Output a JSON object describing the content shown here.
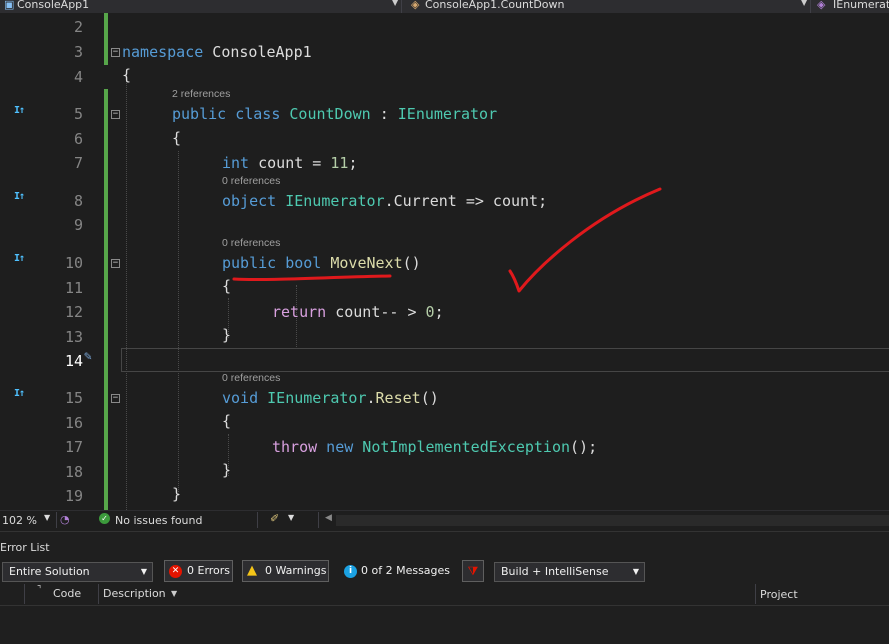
{
  "nav": {
    "project": "ConsoleApp1",
    "type": "ConsoleApp1.CountDown",
    "member": "IEnumerat"
  },
  "editor": {
    "line_numbers": [
      "2",
      "3",
      "4",
      "5",
      "6",
      "7",
      "8",
      "9",
      "10",
      "11",
      "12",
      "13",
      "14",
      "15",
      "16",
      "17",
      "18",
      "19"
    ],
    "ref_labels": {
      "class_refs": "2 references",
      "current_refs": "0 references",
      "movenext_refs": "0 references",
      "reset_refs": "0 references"
    },
    "code": {
      "l3_kw": "namespace",
      "l3_name": " ConsoleApp1",
      "l4": "{",
      "l5_kw": "public class",
      "l5_type": " CountDown",
      "l5_colon": " : ",
      "l5_iface": "IEnumerator",
      "l6": "{",
      "l7_kw": "int",
      "l7_rest": " count = ",
      "l7_num": "11",
      "l7_end": ";",
      "l8_kw": "object",
      "l8_iface": " IEnumerator",
      "l8_rest": ".Current => count;",
      "l10_kw": "public bool",
      "l10_fn": " MoveNext",
      "l10_end": "()",
      "l11": "{",
      "l12_kw": "return",
      "l12_rest": " count-- > ",
      "l12_num": "0",
      "l12_end": ";",
      "l13": "}",
      "l15_kw": "void",
      "l15_iface": " IEnumerator",
      "l15_dot": ".",
      "l15_fn": "Reset",
      "l15_end": "()",
      "l16": "{",
      "l17_kw": "throw",
      "l17_kw2": " new",
      "l17_type": " NotImplementedException",
      "l17_end": "();",
      "l18": "}",
      "l19": "}"
    }
  },
  "status": {
    "zoom": "102 %",
    "issues": "No issues found"
  },
  "error_list": {
    "title": "Error List",
    "scope": "Entire Solution",
    "errors": "0 Errors",
    "warnings": "0 Warnings",
    "messages": "0 of 2 Messages",
    "build_filter": "Build + IntelliSense",
    "columns": {
      "code": "Code",
      "description": "Description",
      "project": "Project"
    }
  },
  "colors": {
    "keyword": "#569cd6",
    "type": "#4ec9b0",
    "method": "#dcdcaa",
    "number": "#b5cea8",
    "control": "#d8a0df",
    "change_bar": "#57a64a",
    "annotation": "#e0191c"
  }
}
